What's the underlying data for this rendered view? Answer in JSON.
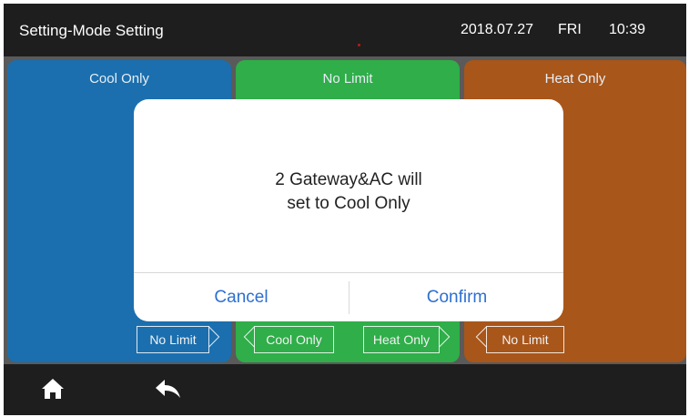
{
  "header": {
    "title": "Setting-Mode Setting",
    "date": "2018.07.27",
    "day": "FRI",
    "time": "10:39"
  },
  "panels": [
    {
      "title": "Cool Only",
      "color": "#1b6fae",
      "tags": [
        "No Limit"
      ]
    },
    {
      "title": "No Limit",
      "color": "#2fae49",
      "tags": [
        "Cool Only",
        "Heat Only"
      ]
    },
    {
      "title": "Heat Only",
      "color": "#a8561a",
      "tags": [
        "No Limit"
      ]
    }
  ],
  "dialog": {
    "message_line1": "2 Gateway&AC will",
    "message_line2": "set to Cool Only",
    "cancel_label": "Cancel",
    "confirm_label": "Confirm",
    "accent": "#2d6fd1"
  },
  "bottom_nav": {
    "icons": [
      "home-icon",
      "back-arrow-icon"
    ]
  }
}
